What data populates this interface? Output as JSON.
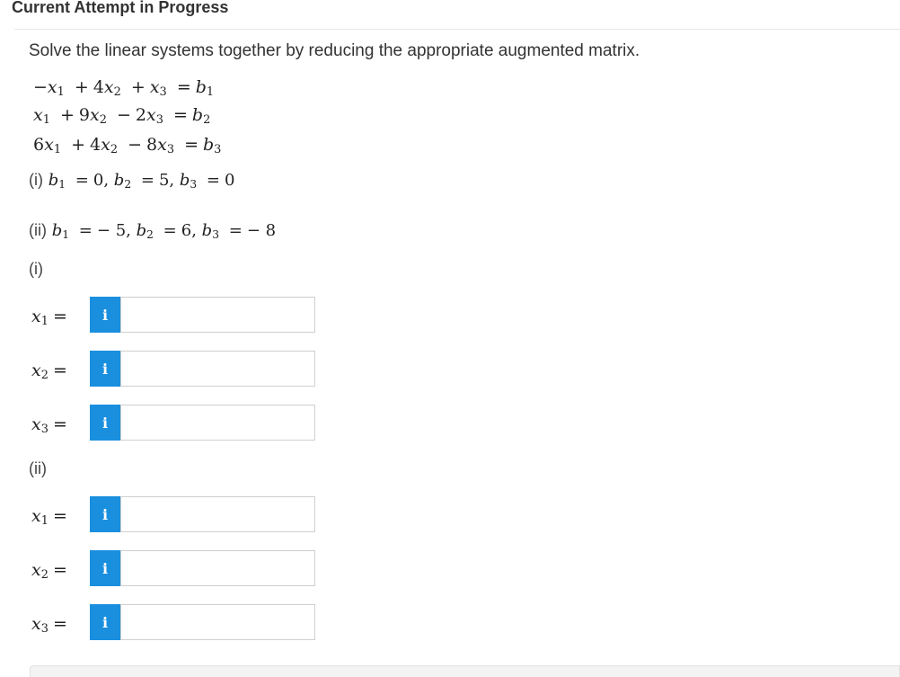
{
  "header": {
    "title": "Current Attempt in Progress"
  },
  "question": {
    "instructions": "Solve the linear systems together by reducing the appropriate augmented matrix.",
    "equations": [
      {
        "sign1": "−",
        "var1": "x",
        "sub1": "1",
        "op1": "+",
        "coef2": "4",
        "var2": "x",
        "sub2": "2",
        "op2": "+",
        "coef3": "",
        "var3": "x",
        "sub3": "3",
        "eq": "=",
        "rhs": "b",
        "rhs_sub": "1"
      },
      {
        "sign1": "",
        "var1": "x",
        "sub1": "1",
        "op1": "+",
        "coef2": "9",
        "var2": "x",
        "sub2": "2",
        "op2": "−",
        "coef3": "2",
        "var3": "x",
        "sub3": "3",
        "eq": "=",
        "rhs": "b",
        "rhs_sub": "2"
      },
      {
        "sign1": "6",
        "var1": "x",
        "sub1": "1",
        "op1": "+",
        "coef2": "4",
        "var2": "x",
        "sub2": "2",
        "op2": "−",
        "coef3": "8",
        "var3": "x",
        "sub3": "3",
        "eq": "=",
        "rhs": "b",
        "rhs_sub": "3"
      }
    ],
    "cases": [
      {
        "label": "(i)",
        "b": "b",
        "s1": "1",
        "v1": "0",
        "s2": "2",
        "v2": "5",
        "s3": "3",
        "v3": "0"
      },
      {
        "label": "(ii)",
        "b": "b",
        "s1": "1",
        "v1": "− 5",
        "s2": "2",
        "v2": "6",
        "s3": "3",
        "v3": "− 8"
      }
    ]
  },
  "answers": {
    "part1": {
      "label": "(i)",
      "rows": [
        {
          "var": "x",
          "sub": "1",
          "eq": "=",
          "info": "i",
          "value": ""
        },
        {
          "var": "x",
          "sub": "2",
          "eq": "=",
          "info": "i",
          "value": ""
        },
        {
          "var": "x",
          "sub": "3",
          "eq": "=",
          "info": "i",
          "value": ""
        }
      ]
    },
    "part2": {
      "label": "(ii)",
      "rows": [
        {
          "var": "x",
          "sub": "1",
          "eq": "=",
          "info": "i",
          "value": ""
        },
        {
          "var": "x",
          "sub": "2",
          "eq": "=",
          "info": "i",
          "value": ""
        },
        {
          "var": "x",
          "sub": "3",
          "eq": "=",
          "info": "i",
          "value": ""
        }
      ]
    }
  },
  "colors": {
    "info_button": "#1a8fde",
    "input_border": "#cfcfcf",
    "text": "#333333"
  }
}
